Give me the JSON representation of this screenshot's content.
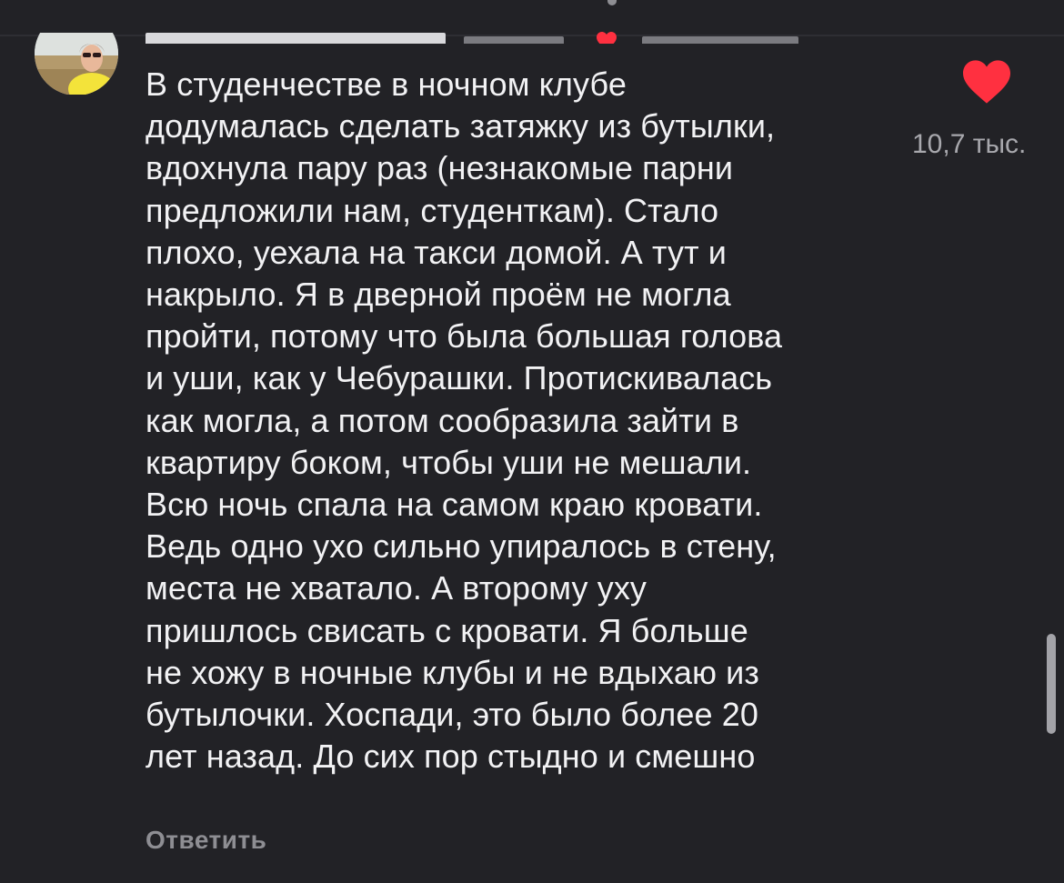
{
  "comment": {
    "text": "В студенчестве в ночном клубе\nдодумалась сделать затяжку из бутылки,\nвдохнула пару раз (незнакомые парни\nпредложили нам, студенткам). Стало\nплохо, уехала на такси домой. А тут и\nнакрыло. Я в дверной проём не могла\nпройти, потому что была большая голова\nи уши, как у Чебурашки. Протискивалась\nкак могла, а потом сообразила зайти в\nквартиру боком, чтобы уши не мешали.\nВсю ночь спала на самом краю кровати.\nВедь одно ухо сильно упиралось в стену,\nместа не хватало. А второму уху\nпришлось свисать с кровати. Я больше\nне хожу в ночные клубы и не вдыхаю из\nбутылочки. Хоспади, это было более 20\nлет назад. До сих пор стыдно и смешно",
    "like_count": "10,7 тыс.",
    "reply_label": "Ответить"
  },
  "icons": {
    "like": "heart-icon",
    "author_like": "heart-icon"
  },
  "colors": {
    "background": "#222226",
    "text": "#f2f2f4",
    "secondary_text": "#8e8e93",
    "like_red": "#ff3040"
  }
}
